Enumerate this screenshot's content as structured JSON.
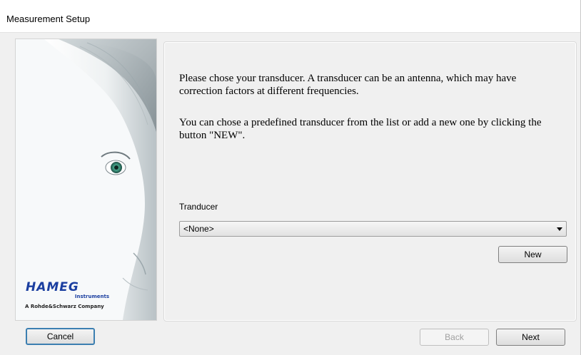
{
  "window": {
    "title": "Measurement Setup"
  },
  "side_panel": {
    "logo_brand": "HAMEG",
    "logo_sub": "Instruments",
    "logo_tagline": "A Rohde&Schwarz Company"
  },
  "content": {
    "paragraph_1": "Please chose your transducer. A transducer can be an antenna, which may have correction factors at different frequencies.",
    "paragraph_2": "You can chose a predefined transducer from the list or add a new one by clicking the button \"NEW\".",
    "transducer_label": "Tranducer",
    "transducer_select": {
      "selected": "<None>"
    },
    "new_button": "New"
  },
  "footer": {
    "cancel_button": "Cancel",
    "back_button": "Back",
    "back_enabled": false,
    "next_button": "Next"
  },
  "colors": {
    "logo_blue": "#1b3fa0",
    "focus_border": "#3c7fb1",
    "eye_green": "#3f9c82"
  }
}
